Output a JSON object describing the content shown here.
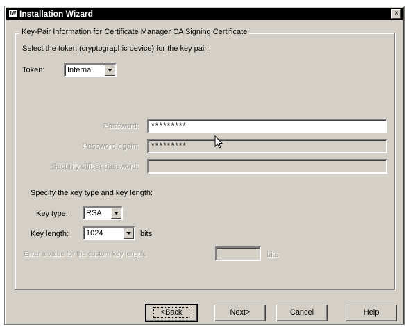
{
  "window": {
    "title": "Installation Wizard",
    "app_icon": "wizard-app-icon",
    "close_glyph": "×"
  },
  "group": {
    "legend": "Key-Pair Information for Certificate Manager CA Signing Certificate",
    "token_prompt": "Select the token (cryptographic device) for the key pair:",
    "token_label": "Token:",
    "token_value": "Internal",
    "password_label": "Password:",
    "password_value": "*********",
    "password_again_label": "Password again:",
    "password_again_value": "*********",
    "sso_label": "Security officer password:",
    "sso_value": "",
    "key_prompt": "Specify the key type and key length:",
    "key_type_label": "Key type:",
    "key_type_value": "RSA",
    "key_length_label": "Key length:",
    "key_length_value": "1024",
    "key_length_unit": "bits",
    "custom_length_label": "Enter a value for the custom key length:",
    "custom_length_value": "",
    "custom_length_unit": "bits"
  },
  "buttons": {
    "back": "<Back",
    "next": "Next>",
    "cancel": "Cancel",
    "help": "Help"
  },
  "colors": {
    "titlebar": "#000000",
    "face": "#d4d0c8",
    "disabled_text": "#a09d96"
  }
}
